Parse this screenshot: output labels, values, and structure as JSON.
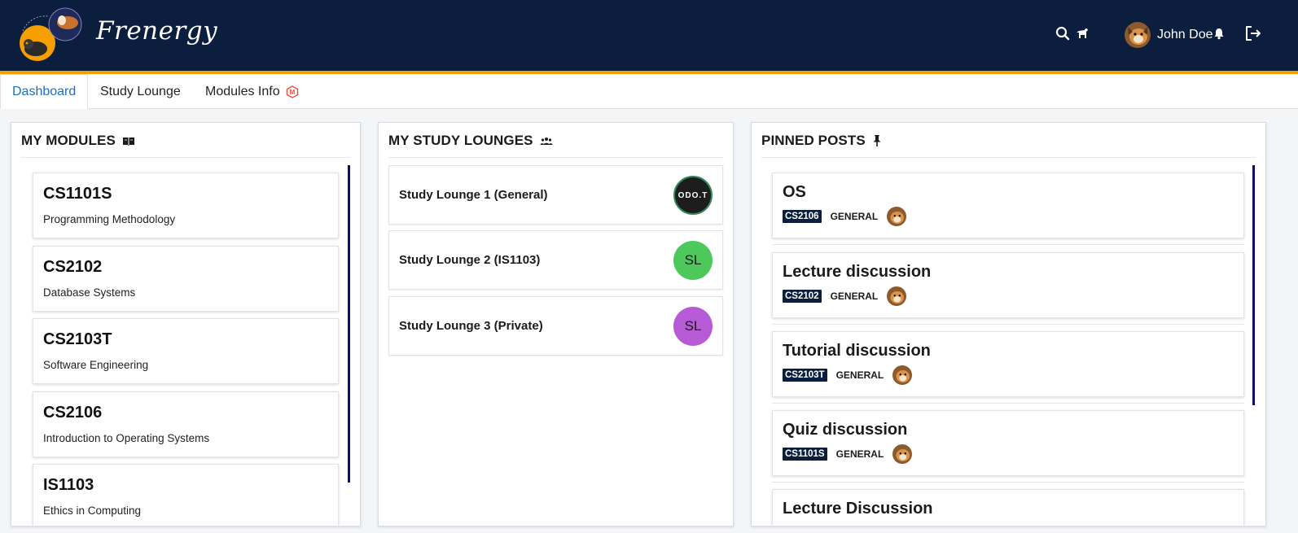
{
  "header": {
    "brand": "Frenergy",
    "user_name": "John Doe",
    "colors": {
      "navy": "#0b1e3e",
      "accent": "#f5a000"
    },
    "icons": [
      "search-icon",
      "dog-icon",
      "bell-icon",
      "logout-icon"
    ]
  },
  "tabs": [
    {
      "label": "Dashboard",
      "active": true
    },
    {
      "label": "Study Lounge",
      "active": false
    },
    {
      "label": "Modules Info",
      "active": false
    }
  ],
  "modules_panel": {
    "title": "MY MODULES",
    "items": [
      {
        "code": "CS1101S",
        "name": "Programming Methodology"
      },
      {
        "code": "CS2102",
        "name": "Database Systems"
      },
      {
        "code": "CS2103T",
        "name": "Software Engineering"
      },
      {
        "code": "CS2106",
        "name": "Introduction to Operating Systems"
      },
      {
        "code": "IS1103",
        "name": "Ethics in Computing"
      }
    ]
  },
  "lounges_panel": {
    "title": "MY STUDY LOUNGES",
    "items": [
      {
        "name": "Study Lounge 1 (General)",
        "avatar_text": "ODO.T",
        "avatar_color": "#1d1d1d"
      },
      {
        "name": "Study Lounge 2 (IS1103)",
        "avatar_text": "SL",
        "avatar_color": "#4cc95a"
      },
      {
        "name": "Study Lounge 3 (Private)",
        "avatar_text": "SL",
        "avatar_color": "#b65ad6"
      }
    ]
  },
  "posts_panel": {
    "title": "PINNED POSTS",
    "items": [
      {
        "title": "OS",
        "code": "CS2106",
        "category": "GENERAL"
      },
      {
        "title": "Lecture discussion",
        "code": "CS2102",
        "category": "GENERAL"
      },
      {
        "title": "Tutorial discussion",
        "code": "CS2103T",
        "category": "GENERAL"
      },
      {
        "title": "Quiz discussion",
        "code": "CS1101S",
        "category": "GENERAL"
      },
      {
        "title": "Lecture Discussion",
        "code": "",
        "category": ""
      }
    ]
  }
}
